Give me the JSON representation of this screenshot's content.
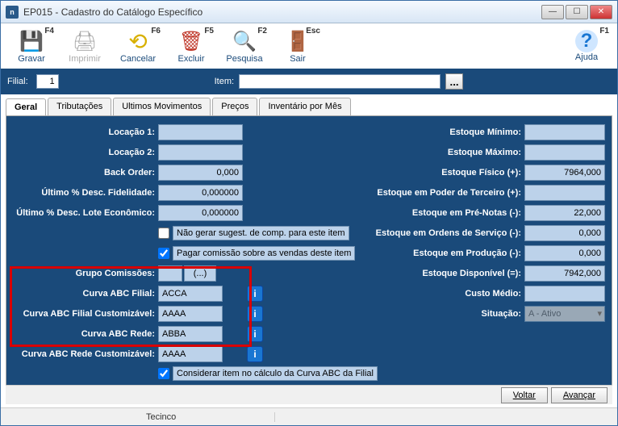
{
  "window": {
    "title": "EP015 - Cadastro do Catálogo Específico"
  },
  "toolbar": {
    "items": [
      {
        "id": "gravar",
        "label": "Gravar",
        "hotkey": "F4",
        "icon": "💾",
        "color": "#3a8a3a"
      },
      {
        "id": "imprimir",
        "label": "Imprimir",
        "hotkey": "",
        "icon": "🖨",
        "color": "#aaa",
        "disabled": true
      },
      {
        "id": "cancelar",
        "label": "Cancelar",
        "hotkey": "F6",
        "icon": "↩",
        "color": "#d8b000"
      },
      {
        "id": "excluir",
        "label": "Excluir",
        "hotkey": "F5",
        "icon": "🗑",
        "color": "#c0392b"
      },
      {
        "id": "pesquisa",
        "label": "Pesquisa",
        "hotkey": "F2",
        "icon": "🔍",
        "color": "#5a7aa5"
      },
      {
        "id": "sair",
        "label": "Sair",
        "hotkey": "Esc",
        "icon": "🚪",
        "color": "#b05a1a"
      }
    ],
    "help": {
      "label": "Ajuda",
      "hotkey": "F1",
      "icon": "?"
    }
  },
  "band": {
    "filial_label": "Filial:",
    "filial_value": "1",
    "item_label": "Item:",
    "item_value": "",
    "lookup": "..."
  },
  "tabs": {
    "items": [
      {
        "id": "geral",
        "label": "Geral",
        "active": true
      },
      {
        "id": "trib",
        "label": "Tributações"
      },
      {
        "id": "mov",
        "label": "Ultimos Movimentos"
      },
      {
        "id": "precos",
        "label": "Preços"
      },
      {
        "id": "inv",
        "label": "Inventário por Mês"
      }
    ]
  },
  "left": {
    "locacao1": {
      "label": "Locação 1:",
      "value": ""
    },
    "locacao2": {
      "label": "Locação 2:",
      "value": ""
    },
    "backorder": {
      "label": "Back Order:",
      "value": "0,000"
    },
    "desc_fid": {
      "label": "Último % Desc. Fidelidade:",
      "value": "0,000000"
    },
    "desc_lote": {
      "label": "Último % Desc. Lote Econômico:",
      "value": "0,000000"
    },
    "chk_nao_gerar": {
      "label": "Não gerar sugest. de comp. para este item",
      "checked": false
    },
    "chk_comissao": {
      "label": "Pagar comissão sobre as vendas deste item",
      "checked": true
    },
    "grupo_com": {
      "label": "Grupo Comissões:",
      "value": "",
      "btn": "(...)"
    },
    "abc_filial": {
      "label": "Curva ABC Filial:",
      "value": "ACCA"
    },
    "abc_filial_cust": {
      "label": "Curva ABC Filial Customizável:",
      "value": "AAAA"
    },
    "abc_rede": {
      "label": "Curva ABC Rede:",
      "value": "ABBA"
    },
    "abc_rede_cust": {
      "label": "Curva ABC Rede Customizável:",
      "value": "AAAA"
    },
    "chk_considerar": {
      "label": "Considerar item no cálculo da Curva ABC da Filial",
      "checked": true
    }
  },
  "right": {
    "est_min": {
      "label": "Estoque Mínimo:",
      "value": ""
    },
    "est_max": {
      "label": "Estoque Máximo:",
      "value": ""
    },
    "est_fis": {
      "label": "Estoque Físico (+):",
      "value": "7964,000"
    },
    "est_terc": {
      "label": "Estoque em Poder de Terceiro (+):",
      "value": ""
    },
    "est_pre": {
      "label": "Estoque em Pré-Notas (-):",
      "value": "22,000"
    },
    "est_ord": {
      "label": "Estoque em Ordens de Serviço (-):",
      "value": "0,000"
    },
    "est_prod": {
      "label": "Estoque em Produção (-):",
      "value": "0,000"
    },
    "est_disp": {
      "label": "Estoque Disponível (=):",
      "value": "7942,000"
    },
    "custo": {
      "label": "Custo Médio:",
      "value": ""
    },
    "situacao": {
      "label": "Situação:",
      "value": "A - Ativo"
    }
  },
  "footer": {
    "voltar": "Voltar",
    "avancar": "Avançar"
  },
  "status": {
    "user": "Tecinco"
  }
}
